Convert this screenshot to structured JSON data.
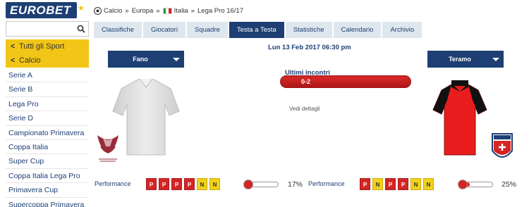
{
  "brand": {
    "logo_text": "EUROBET"
  },
  "search": {
    "placeholder": ""
  },
  "sidebar": {
    "back_items": [
      {
        "label": "Tutti gli Sport"
      },
      {
        "label": "Calcio"
      }
    ],
    "leagues": [
      {
        "label": "Serie A"
      },
      {
        "label": "Serie B"
      },
      {
        "label": "Lega Pro"
      },
      {
        "label": "Serie D"
      },
      {
        "label": "Campionato Primavera"
      },
      {
        "label": "Coppa Italia"
      },
      {
        "label": "Super Cup"
      },
      {
        "label": "Coppa Italia Lega Pro"
      },
      {
        "label": "Primavera Cup"
      },
      {
        "label": "Supercoppa Primavera"
      }
    ]
  },
  "breadcrumb": [
    "Calcio",
    "Europa",
    "Italia",
    "Lega Pro 16/17"
  ],
  "tabs": [
    {
      "label": "Classifiche",
      "active": false
    },
    {
      "label": "Giocatori",
      "active": false
    },
    {
      "label": "Squadre",
      "active": false
    },
    {
      "label": "Testa a Testa",
      "active": true
    },
    {
      "label": "Statistiche",
      "active": false
    },
    {
      "label": "Calendario",
      "active": false
    },
    {
      "label": "Archivio",
      "active": false
    }
  ],
  "match": {
    "date": "Lun 13 Feb 2017 06:30 pm",
    "home_team": "Fano",
    "away_team": "Teramo",
    "last_matches_title": "Ultimi incontri",
    "last_result": "0-2",
    "details_link": "Vedi dettagli"
  },
  "performance": {
    "label": "Performance",
    "home": {
      "results": [
        "P",
        "P",
        "P",
        "P",
        "N",
        "N"
      ],
      "percent_text": "17%",
      "percent": 0.17
    },
    "away": {
      "results": [
        "P",
        "N",
        "P",
        "P",
        "N",
        "N"
      ],
      "percent_text": "25%",
      "percent": 0.25
    }
  },
  "colors": {
    "brand_blue": "#1d3f73",
    "accent_yellow": "#f2c617",
    "loss_red": "#d42525",
    "draw_yellow": "#f2d21a",
    "home_shirt": "#e2e2e2",
    "away_shirt_body": "#e81c1c",
    "away_shirt_sleeves": "#111111"
  }
}
